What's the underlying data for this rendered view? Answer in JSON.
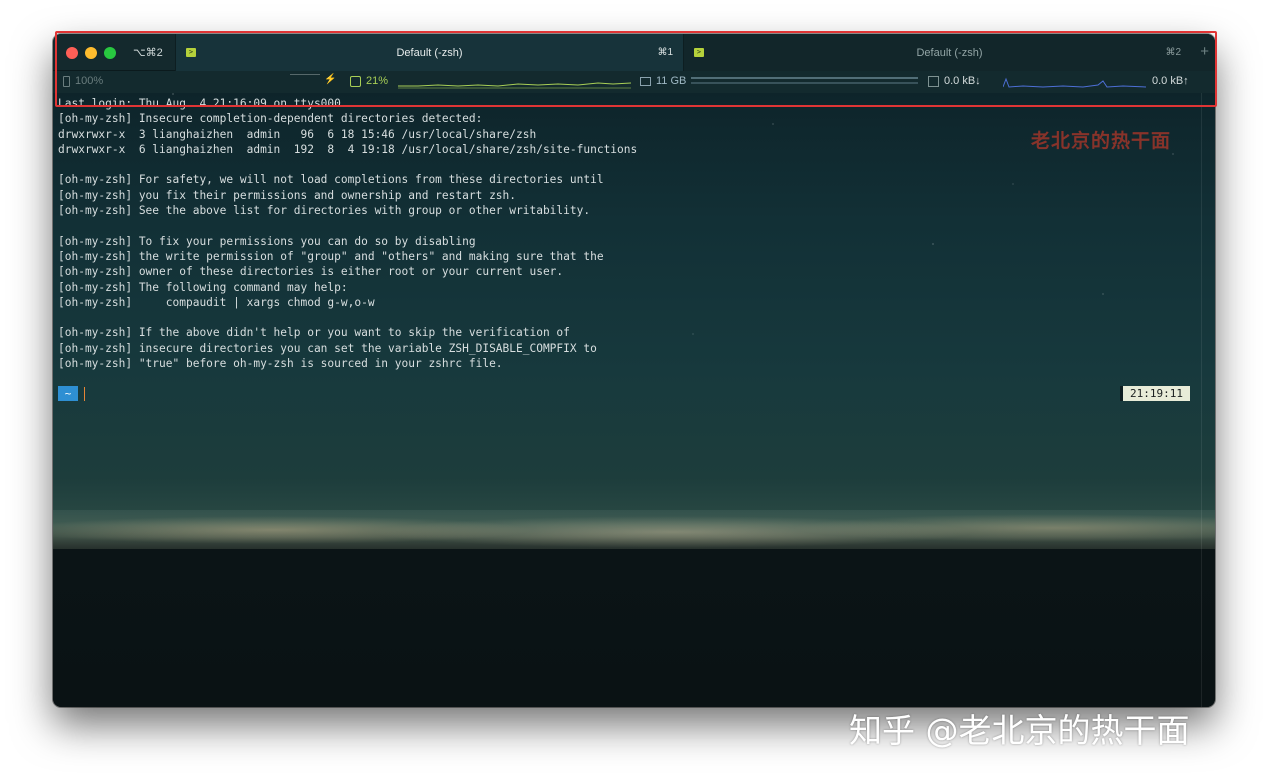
{
  "window": {
    "shortcut": "⌥⌘2"
  },
  "tabs": [
    {
      "title": "Default (-zsh)",
      "shortcut": "⌘1",
      "icon": "terminal-icon",
      "active": true
    },
    {
      "title": "Default (-zsh)",
      "shortcut": "⌘2",
      "icon": "terminal-icon",
      "active": false
    }
  ],
  "new_tab_symbol": "+",
  "status_bar": {
    "battery": "100%",
    "battery_charging_symbol": "⚡",
    "cpu": "21%",
    "memory": "11 GB",
    "network_down": "0.0 kB↓",
    "network_up": "0.0 kB↑"
  },
  "terminal": {
    "lines": [
      "Last login: Thu Aug  4 21:16:09 on ttys000",
      "[oh-my-zsh] Insecure completion-dependent directories detected:",
      "drwxrwxr-x  3 lianghaizhen  admin   96  6 18 15:46 /usr/local/share/zsh",
      "drwxrwxr-x  6 lianghaizhen  admin  192  8  4 19:18 /usr/local/share/zsh/site-functions",
      "",
      "[oh-my-zsh] For safety, we will not load completions from these directories until",
      "[oh-my-zsh] you fix their permissions and ownership and restart zsh.",
      "[oh-my-zsh] See the above list for directories with group or other writability.",
      "",
      "[oh-my-zsh] To fix your permissions you can do so by disabling",
      "[oh-my-zsh] the write permission of \"group\" and \"others\" and making sure that the",
      "[oh-my-zsh] owner of these directories is either root or your current user.",
      "[oh-my-zsh] The following command may help:",
      "[oh-my-zsh]     compaudit | xargs chmod g-w,o-w",
      "",
      "[oh-my-zsh] If the above didn't help or you want to skip the verification of",
      "[oh-my-zsh] insecure directories you can set the variable ZSH_DISABLE_COMPFIX to",
      "[oh-my-zsh] \"true\" before oh-my-zsh is sourced in your zshrc file."
    ],
    "prompt_dir": "~",
    "last_status": "ok",
    "time": "21:19:11"
  },
  "watermarks": {
    "top_right": "老北京的热干面",
    "bottom": "知乎 @老北京的热干面"
  },
  "colors": {
    "highlight_box": "#e03535",
    "cpu_green": "#a8cf56",
    "prompt_blue": "#2e8fd3"
  }
}
